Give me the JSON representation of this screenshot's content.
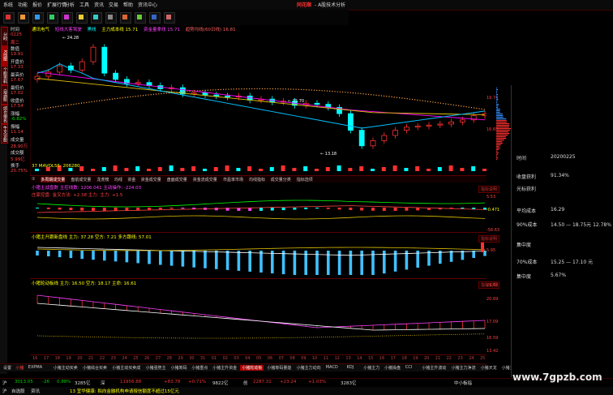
{
  "app": {
    "brand": "同花顺",
    "title": "- A股技术分析"
  },
  "menu": [
    "系统",
    "功能",
    "报价",
    "扩展行情",
    "分析",
    "工具",
    "资讯",
    "交易",
    "帮助",
    "资讯中心"
  ],
  "toolbar": [
    "首页",
    "自选",
    "全景",
    "资讯",
    "F10",
    "交易"
  ],
  "sidebar_tabs": [
    "分时",
    "K线图",
    "个股资料",
    "自选股",
    "综合排名",
    "牛叉诊股"
  ],
  "datacol": {
    "rows": [
      {
        "label": "时间",
        "value": "2020"
      },
      {
        "label": "",
        "value": "0225"
      },
      {
        "label": "",
        "value": "周二"
      },
      {
        "label": "数值",
        "value": ""
      },
      {
        "label": "",
        "value": "19.91"
      },
      {
        "label": "开盘价",
        "value": ""
      },
      {
        "label": "",
        "value": "17.33"
      },
      {
        "label": "最高价",
        "value": ""
      },
      {
        "label": "",
        "value": "17.67"
      },
      {
        "label": "最低价",
        "value": ""
      },
      {
        "label": "",
        "value": "17.02"
      },
      {
        "label": "收盘价",
        "value": ""
      },
      {
        "label": "",
        "value": "17.54"
      },
      {
        "label": "涨幅",
        "value": ""
      },
      {
        "label": "",
        "value": "-6.82%"
      },
      {
        "label": "振幅",
        "value": ""
      },
      {
        "label": "",
        "value": "11.14"
      },
      {
        "label": "成交量",
        "value": ""
      },
      {
        "label": "",
        "value": "28.90万"
      },
      {
        "label": "成交额",
        "value": ""
      },
      {
        "label": "",
        "value": "5.99亿"
      },
      {
        "label": "换手",
        "value": ""
      },
      {
        "label": "",
        "value": "20.75%"
      }
    ]
  },
  "main_legend": {
    "name": "通讯电气",
    "items": [
      "短线大客驾驶",
      "黑线",
      "主力成本线 15.71",
      "资金量拿线 15.71",
      "趋势均线(60日线) 16.81"
    ]
  },
  "main_annotations": {
    "high": "24.28",
    "low": "13.18",
    "mid": "15.70"
  },
  "main_scale": [
    "19.74",
    "16.65"
  ],
  "vol_legend": "37 MAVOL55: 206280",
  "indicator_tabs": [
    "①",
    "多周期成交量",
    "盘前成交量",
    "龙虎榜",
    "均线",
    "资金",
    "资金成交量",
    "盘面成交量",
    "资金流成交量",
    "市盈率市场",
    "均线指标",
    "成交量分类",
    "指标选项"
  ],
  "pane1": {
    "legend1": "小猪主战盘数 主控线数: 1206.041  主动操作: -224.03",
    "legend2": "庄家控盘: 金叉方法: +2.38  主力: 主力: +1.5",
    "btn": "指标说明",
    "scale": [
      "5.53",
      "-0.471",
      "-56.63"
    ]
  },
  "pane2": {
    "legend": "小猪主升跟新盘线 主力: 37.28  空方: 7.21  多方跟线: 57.01",
    "btn": "指标说明",
    "scale": [
      "5.95"
    ]
  },
  "pane3": {
    "legend": "小猪轮动板线 主力: 16.50  空方: 18.17  主命: 16.61",
    "btn": "指标说明",
    "scale": [
      "21.03",
      "20.69",
      "17.09",
      "16.59",
      "13.42"
    ]
  },
  "dates": [
    "16",
    "17",
    "18",
    "19",
    "20",
    "21",
    "22",
    "23",
    "24",
    "25",
    "26",
    "27",
    "28",
    "29",
    "30",
    "31",
    "01",
    "02",
    "03",
    "04",
    "05",
    "06",
    "07",
    "08",
    "09",
    "10",
    "11",
    "12",
    "13",
    "14",
    "15",
    "16",
    "17",
    "18",
    "19",
    "20",
    "21",
    "22",
    "23",
    "24",
    "25"
  ],
  "bottom_tabs": [
    "设置",
    "小猪",
    "EXPMA",
    "小猪主动买卖",
    "小猪综合买卖",
    "小猪主动买卖成",
    "小猪强势主",
    "小猪筹码",
    "小猪重点",
    "小猪主升资金",
    "小猪轮动板",
    "小猪筹码量能",
    "小猪主力动向",
    "MACD",
    "KDJ",
    "小猪主力",
    "小猪操盘",
    "CCI",
    "小猪主升波动",
    "小猪主力净流",
    "小猪天龙",
    "小猪主力吸筹"
  ],
  "ticker": [
    {
      "t": "沪",
      "c": "#ddd"
    },
    {
      "t": "3013.05",
      "c": "#0c0"
    },
    {
      "t": "-26",
      "c": "#0c0"
    },
    {
      "t": "0.88%",
      "c": "#0c0"
    },
    {
      "t": "3285亿",
      "c": "#ddd"
    },
    {
      "t": "深",
      "c": "#ddd"
    },
    {
      "t": "11956.88",
      "c": "#e33"
    },
    {
      "t": "+83.78",
      "c": "#e33"
    },
    {
      "t": "+0.71%",
      "c": "#e33"
    },
    {
      "t": "9822亿",
      "c": "#ddd"
    },
    {
      "t": "创",
      "c": "#ddd"
    },
    {
      "t": "2287.31",
      "c": "#e33"
    },
    {
      "t": "+23.24",
      "c": "#e33"
    },
    {
      "t": "+1.03%",
      "c": "#e33"
    },
    {
      "t": "3283亿",
      "c": "#ddd"
    },
    {
      "t": "中小板指",
      "c": "#ddd"
    }
  ],
  "news": [
    {
      "t": "沪",
      "c": "#ddd"
    },
    {
      "t": "自选股",
      "c": "#ddd"
    },
    {
      "t": "资讯",
      "c": "#ddd"
    },
    {
      "t": "13 宜华健康: 拟向金融机构申请授信额度不超过15亿元",
      "c": "#ff0"
    }
  ],
  "right_panel": {
    "rows": [
      {
        "l": "时间",
        "v": "20200225"
      },
      {
        "l": "收盘获利",
        "v": "91.34%"
      },
      {
        "l": "光标获利",
        "v": ""
      },
      {
        "l": "平均成本",
        "v": "16.29"
      },
      {
        "l": "90%成本",
        "v": "14.50 — 18.75元 12.78%"
      },
      {
        "l": "集中度",
        "v": ""
      },
      {
        "l": "70%成本",
        "v": "15.25 — 17.10 元"
      },
      {
        "l": "集中度",
        "v": "5.67%"
      }
    ]
  },
  "watermark": "www.7gpzb.com",
  "colors": {
    "up": "#ff3030",
    "down": "#00ffff",
    "ma1": "#ffffff",
    "ma2": "#e0c000",
    "ma3": "#ff00ff",
    "dots": "#ffa040",
    "cyanline": "#00c0ff"
  }
}
